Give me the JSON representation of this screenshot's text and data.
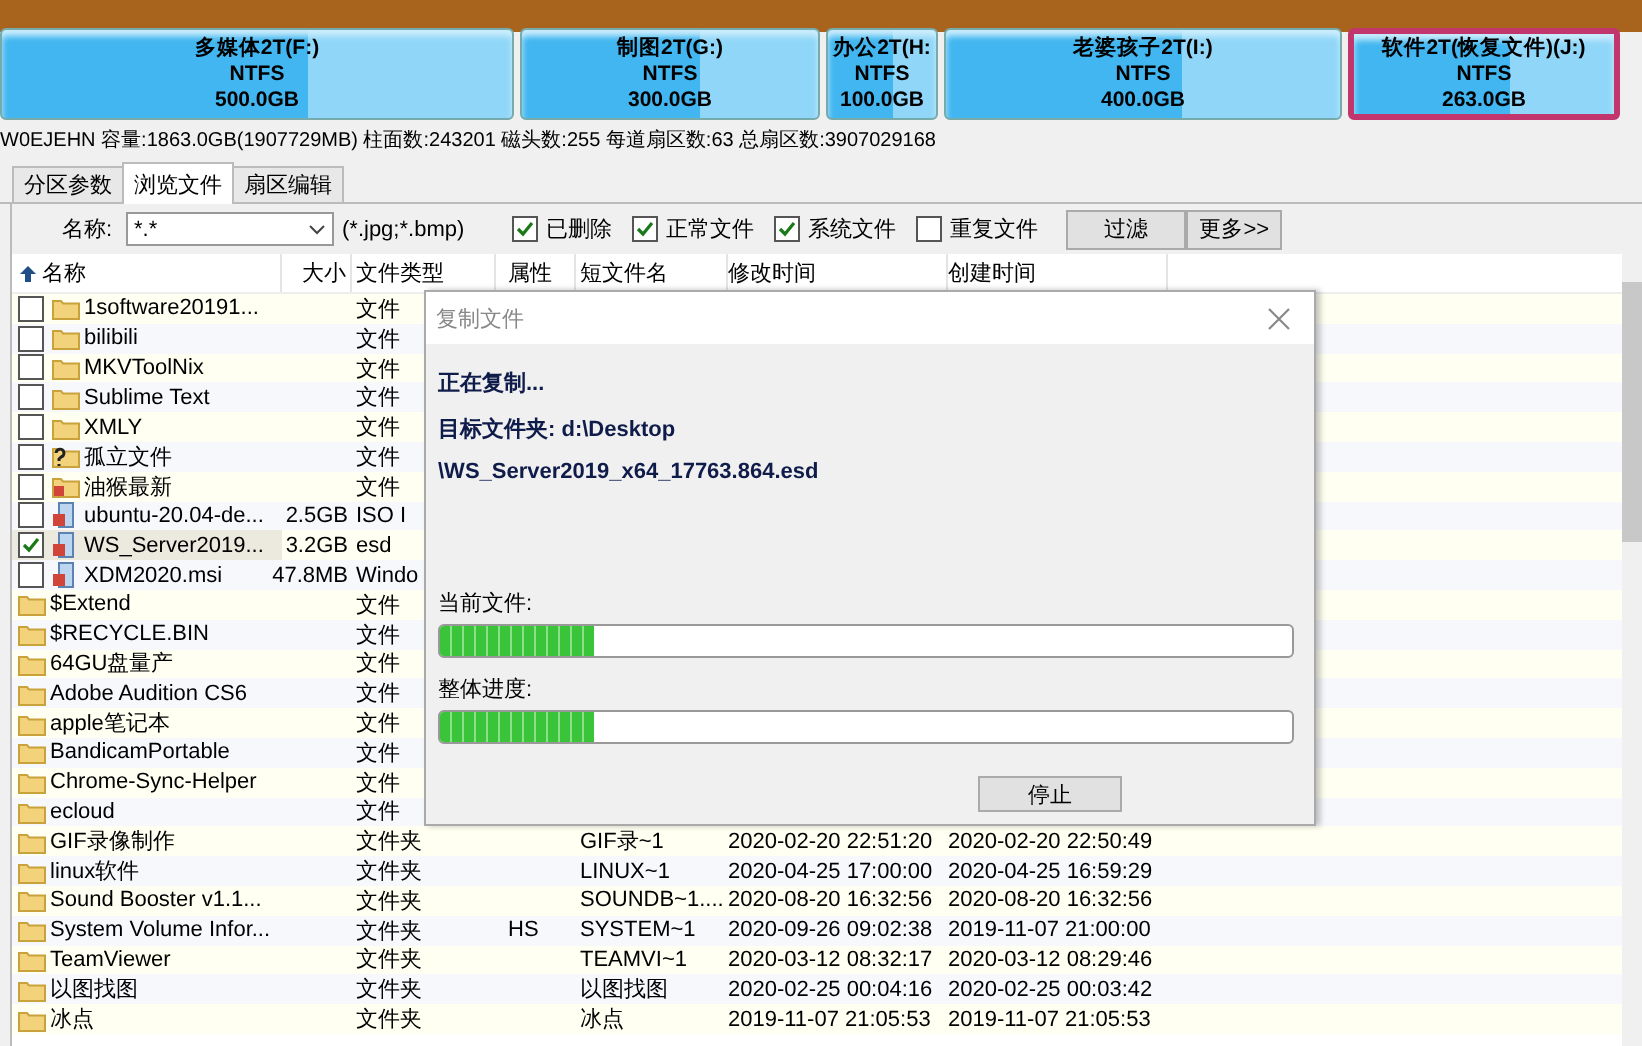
{
  "partitions": [
    {
      "name": "多媒体2T(F:)",
      "fs": "NTFS",
      "size": "500.0GB",
      "selected": false
    },
    {
      "name": "制图2T(G:)",
      "fs": "NTFS",
      "size": "300.0GB",
      "selected": false
    },
    {
      "name": "办公2T(H:",
      "fs": "NTFS",
      "size": "100.0GB",
      "selected": false
    },
    {
      "name": "老婆孩子2T(I:)",
      "fs": "NTFS",
      "size": "400.0GB",
      "selected": false
    },
    {
      "name": "软件2T(恢复文件)(J:)",
      "fs": "NTFS",
      "size": "263.0GB",
      "selected": true
    }
  ],
  "disk_info": "W0EJEHN 容量:1863.0GB(1907729MB) 柱面数:243201 磁头数:255 每道扇区数:63 总扇区数:3907029168",
  "tabs": [
    {
      "label": "分区参数",
      "selected": false
    },
    {
      "label": "浏览文件",
      "selected": true
    },
    {
      "label": "扇区编辑",
      "selected": false
    }
  ],
  "filter": {
    "name_label": "名称:",
    "name_value": "*.*",
    "hint": "(*.jpg;*.bmp)",
    "options": [
      {
        "label": "已删除",
        "checked": true
      },
      {
        "label": "正常文件",
        "checked": true
      },
      {
        "label": "系统文件",
        "checked": true
      },
      {
        "label": "重复文件",
        "checked": false
      }
    ],
    "buttons": [
      "过滤",
      "更多>>"
    ]
  },
  "table": {
    "columns": [
      "名称",
      "大小",
      "文件类型",
      "属性",
      "短文件名",
      "修改时间",
      "创建时间"
    ],
    "rows": [
      {
        "kind": "folder",
        "checked": false,
        "selected": false,
        "name": "1software20191...",
        "type": "文件"
      },
      {
        "kind": "folder",
        "checked": false,
        "selected": false,
        "name": "bilibili",
        "type": "文件"
      },
      {
        "kind": "folder",
        "checked": false,
        "selected": false,
        "name": "MKVToolNix",
        "type": "文件"
      },
      {
        "kind": "folder",
        "checked": false,
        "selected": false,
        "name": "Sublime Text",
        "type": "文件"
      },
      {
        "kind": "folder",
        "checked": false,
        "selected": false,
        "name": "XMLY",
        "type": "文件"
      },
      {
        "kind": "orphan",
        "checked": false,
        "selected": false,
        "name": "孤立文件",
        "type": "文件"
      },
      {
        "kind": "marked",
        "checked": false,
        "selected": false,
        "name": "油猴最新",
        "type": "文件"
      },
      {
        "kind": "file",
        "checked": false,
        "selected": false,
        "name": "ubuntu-20.04-de...",
        "size": "2.5GB",
        "type": "ISO I"
      },
      {
        "kind": "file",
        "checked": true,
        "selected": true,
        "name": "WS_Server2019...",
        "size": "3.2GB",
        "type": "esd"
      },
      {
        "kind": "file",
        "checked": false,
        "selected": false,
        "name": "XDM2020.msi",
        "size": "47.8MB",
        "type": "Windo"
      },
      {
        "kind": "folder",
        "selected": false,
        "name": "$Extend",
        "type": "文件"
      },
      {
        "kind": "folder",
        "selected": false,
        "name": "$RECYCLE.BIN",
        "type": "文件"
      },
      {
        "kind": "folder",
        "selected": false,
        "name": "64GU盘量产",
        "type": "文件"
      },
      {
        "kind": "folder",
        "selected": false,
        "name": "Adobe Audition CS6",
        "type": "文件"
      },
      {
        "kind": "folder",
        "selected": false,
        "name": "apple笔记本",
        "type": "文件"
      },
      {
        "kind": "folder",
        "selected": false,
        "name": "BandicamPortable",
        "type": "文件"
      },
      {
        "kind": "folder",
        "selected": false,
        "name": "Chrome-Sync-Helper",
        "type": "文件"
      },
      {
        "kind": "folder",
        "selected": false,
        "name": "ecloud",
        "type": "文件"
      },
      {
        "kind": "folder",
        "selected": false,
        "name": "GIF录像制作",
        "type": "文件夹",
        "short_name": "GIF录~1",
        "modified": "2020-02-20 22:51:20",
        "created": "2020-02-20 22:50:49"
      },
      {
        "kind": "folder",
        "selected": false,
        "name": "linux软件",
        "type": "文件夹",
        "short_name": "LINUX~1",
        "modified": "2020-04-25 17:00:00",
        "created": "2020-04-25 16:59:29"
      },
      {
        "kind": "folder",
        "selected": false,
        "name": "Sound Booster v1.1...",
        "type": "文件夹",
        "short_name": "SOUNDB~1....",
        "modified": "2020-08-20 16:32:56",
        "created": "2020-08-20 16:32:56"
      },
      {
        "kind": "folder",
        "selected": false,
        "name": "System Volume Infor...",
        "type": "文件夹",
        "attr": "HS",
        "short_name": "SYSTEM~1",
        "modified": "2020-09-26 09:02:38",
        "created": "2019-11-07 21:00:00"
      },
      {
        "kind": "folder",
        "selected": false,
        "name": "TeamViewer",
        "type": "文件夹",
        "short_name": "TEAMVI~1",
        "modified": "2020-03-12 08:32:17",
        "created": "2020-03-12 08:29:46"
      },
      {
        "kind": "folder",
        "selected": false,
        "name": "以图找图",
        "type": "文件夹",
        "short_name": "以图找图",
        "modified": "2020-02-25 00:04:16",
        "created": "2020-02-25 00:03:42"
      },
      {
        "kind": "folder",
        "selected": false,
        "name": "冰点",
        "type": "文件夹",
        "short_name": "冰点",
        "modified": "2019-11-07 21:05:53",
        "created": "2019-11-07 21:05:53"
      }
    ]
  },
  "dialog": {
    "title": "复制文件",
    "status": "正在复制...",
    "target": "目标文件夹: d:\\Desktop",
    "file": "\\WS_Server2019_x64_17763.864.esd",
    "progress": [
      {
        "label": "当前文件:",
        "level": 0.18
      },
      {
        "label": "整体进度:",
        "level": 0.18
      }
    ],
    "button": "停止"
  }
}
